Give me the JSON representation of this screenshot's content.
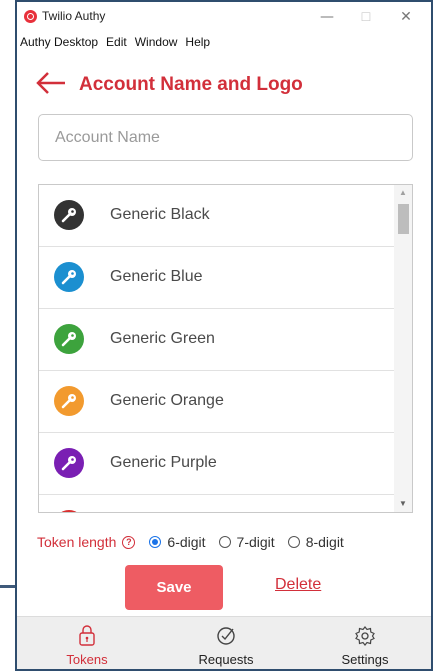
{
  "window": {
    "title": "Twilio Authy",
    "controls": {
      "minimize": "—",
      "maximize": "☐",
      "close": "✕"
    }
  },
  "menu": [
    "Authy Desktop",
    "Edit",
    "Window",
    "Help"
  ],
  "header": {
    "title": "Account Name and Logo",
    "back_icon": "left-arrow-icon"
  },
  "account_name_input": {
    "value": "",
    "placeholder": "Account Name"
  },
  "logos": [
    {
      "label": "Generic Black",
      "color": "#333333"
    },
    {
      "label": "Generic Blue",
      "color": "#1b8fd0"
    },
    {
      "label": "Generic Green",
      "color": "#3da33d"
    },
    {
      "label": "Generic Orange",
      "color": "#f29a2e"
    },
    {
      "label": "Generic Purple",
      "color": "#7a1fb3"
    },
    {
      "label": "",
      "color": "#d9302f"
    }
  ],
  "token_length": {
    "label": "Token length",
    "options": [
      "6-digit",
      "7-digit",
      "8-digit"
    ],
    "selected": "6-digit"
  },
  "actions": {
    "save_label": "Save",
    "delete_label": "Delete"
  },
  "tabs": [
    {
      "label": "Tokens",
      "icon": "lock-icon",
      "active": true
    },
    {
      "label": "Requests",
      "icon": "check-circle-icon",
      "active": false
    },
    {
      "label": "Settings",
      "icon": "gear-icon",
      "active": false
    }
  ],
  "colors": {
    "accent": "#d22f3a",
    "save_button": "#ee5c63",
    "window_border": "#2f4d6e"
  }
}
